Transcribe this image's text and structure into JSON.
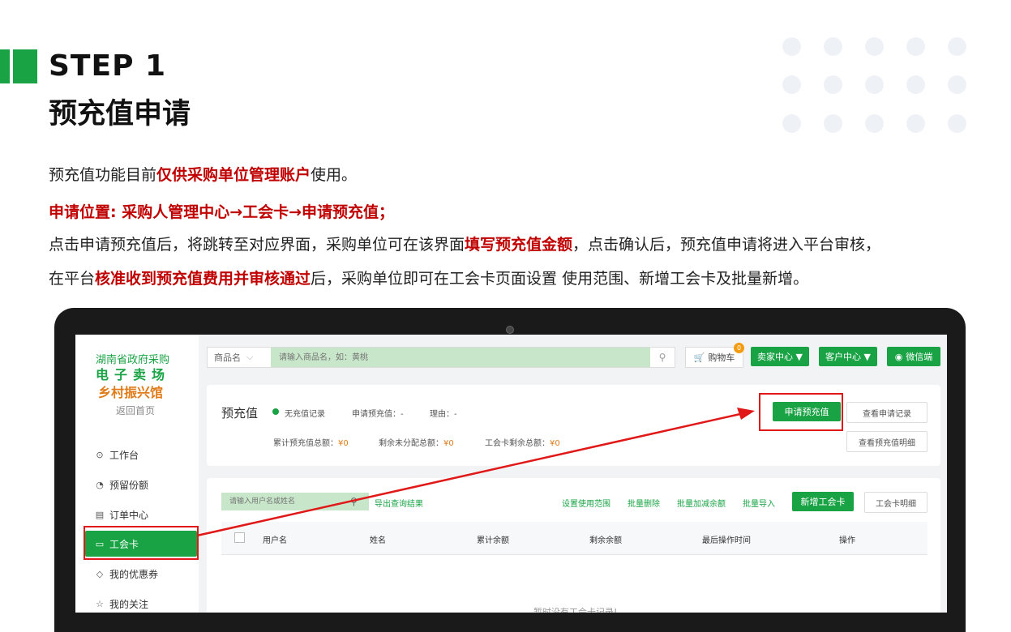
{
  "header": {
    "step": "STEP 1",
    "title": "预充值申请"
  },
  "intro": {
    "p1_a": "预充值功能目前",
    "p1_b": "仅供采购单位管理账户",
    "p1_c": "使用。",
    "p2": "申请位置: 采购人管理中心→工会卡→申请预充值；",
    "p3_a": "点击申请预充值后，将跳转至对应界面，采购单位可在该界面",
    "p3_b": "填写预充值金额",
    "p3_c": "，点击确认后，预充值申请将进入平台审核，",
    "p4_a": "在平台",
    "p4_b": "核准收到预充值费用并审核通过",
    "p4_c": "后，采购单位即可在工会卡页面设置 使用范围、新增工会卡及批量新增。"
  },
  "app": {
    "logo_line1": "湖南省政府采购",
    "logo_line2": "电子卖场",
    "logo_line3": "乡村振兴馆",
    "back_home": "返回首页",
    "menu": [
      {
        "label": "工作台",
        "icon": "⊙"
      },
      {
        "label": "预留份额",
        "icon": "◔"
      },
      {
        "label": "订单中心",
        "icon": "▤"
      },
      {
        "label": "工会卡",
        "icon": "▭"
      },
      {
        "label": "我的优惠券",
        "icon": "◇"
      },
      {
        "label": "我的关注",
        "icon": "☆"
      }
    ],
    "search": {
      "category": "商品名",
      "placeholder": "请输入商品名，如：黄桃"
    },
    "cart_label": "购物车",
    "cart_count": "0",
    "seller_center": "卖家中心 ▼",
    "customer_center": "客户中心 ▼",
    "wechat": "微信端",
    "prepaid": {
      "title": "预充值",
      "status": "无充值记录",
      "apply_amount_label": "申请预充值：-",
      "reason_label": "理由：-",
      "total_label": "累计预充值总额：",
      "total_value": "¥0",
      "unallocated_label": "剩余未分配总额：",
      "unallocated_value": "¥0",
      "card_remaining_label": "工会卡剩余总额：",
      "card_remaining_value": "¥0",
      "apply_button": "申请预充值",
      "view_records": "查看申请记录",
      "view_details": "查看预充值明细"
    },
    "cards": {
      "user_search_placeholder": "请输入用户名或姓名",
      "export": "导出查询结果",
      "set_scope": "设置使用范围",
      "batch_delete": "批量删除",
      "batch_adjust": "批量加减余额",
      "batch_import": "批量导入",
      "new_card": "新增工会卡",
      "card_detail": "工会卡明细",
      "columns": [
        "用户名",
        "姓名",
        "累计余额",
        "剩余余额",
        "最后操作时间",
        "操作"
      ],
      "empty": "暂时没有工会卡记录!"
    }
  },
  "colors": {
    "brand_green": "#1aa345",
    "highlight_red": "#e01818",
    "text_red": "#c00000",
    "orange": "#e07b1a"
  }
}
